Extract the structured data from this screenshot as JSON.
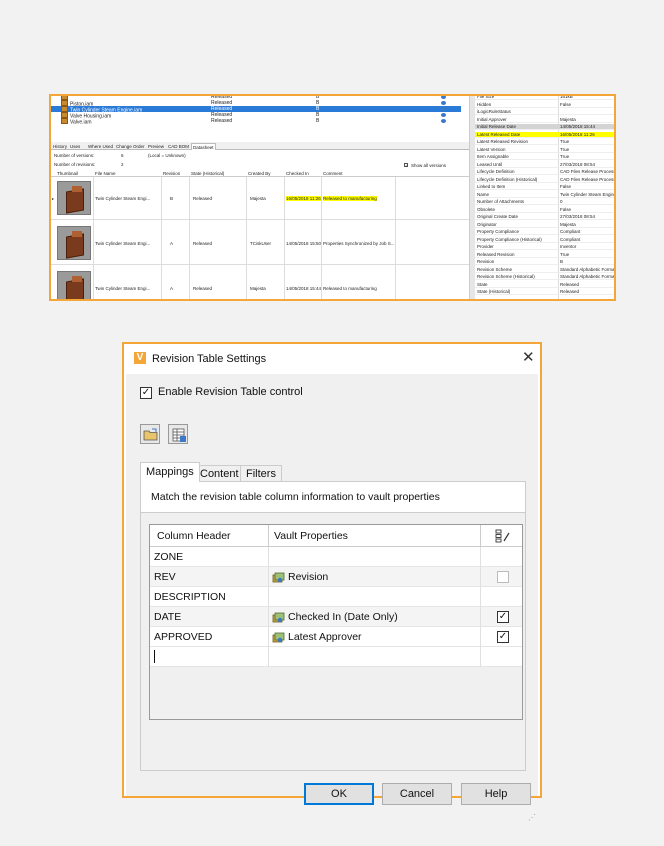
{
  "vault": {
    "files": [
      {
        "name": "",
        "state": "Released",
        "rev": "B",
        "selected": false
      },
      {
        "name": "Piston.iam",
        "state": "Released",
        "rev": "B",
        "selected": false
      },
      {
        "name": "Twin Cylinder Steam Engine.iam",
        "state": "Released",
        "rev": "B",
        "selected": true
      },
      {
        "name": "Valve Housing.iam",
        "state": "Released",
        "rev": "B",
        "selected": false
      },
      {
        "name": "Valve.iam",
        "state": "Released",
        "rev": "B",
        "selected": false
      }
    ],
    "tabs": [
      "History",
      "Uses",
      "Where Used",
      "Change Order",
      "Preview",
      "CAD BOM",
      "Datasheet"
    ],
    "versions_label": "Number of versions:",
    "versions_value": "6",
    "local_note": "(Local = Unknown)",
    "revisions_label": "Number of revisions:",
    "revisions_value": "2",
    "show_all": "Show all versions",
    "history_headers": [
      "Thumbnail",
      "File Name",
      "Revision",
      "State (Historical)",
      "Created By",
      "Checked In",
      "Comment"
    ],
    "history_rows": [
      {
        "file": "Twin Cylinder Steam Engi...",
        "rev": "B",
        "state": "Released",
        "by": "Majesta",
        "checked": "16/05/2018 11:26",
        "comment": "Released to manufacturing",
        "highlight": true
      },
      {
        "file": "Twin Cylinder Steam Engi...",
        "rev": "A",
        "state": "Released",
        "by": "TCiskUser",
        "checked": "14/05/2018 15:50",
        "comment": "Properties Synchronized by Job S...",
        "highlight": false
      },
      {
        "file": "Twin Cylinder Steam Engi...",
        "rev": "A",
        "state": "Released",
        "by": "Majesta",
        "checked": "14/05/2018 15:44",
        "comment": "Released to manufacturing",
        "highlight": false
      }
    ],
    "properties": [
      {
        "name": "File Size",
        "value": "161kB",
        "style": ""
      },
      {
        "name": "Hidden",
        "value": "False",
        "style": ""
      },
      {
        "name": "iLogicRuleStatus",
        "value": "",
        "style": ""
      },
      {
        "name": "Initial Approver",
        "value": "Majesta",
        "style": ""
      },
      {
        "name": "Initial Release Date",
        "value": "14/05/2018 15:44",
        "style": "gray"
      },
      {
        "name": "Latest Released Date",
        "value": "16/05/2018 11:26",
        "style": "yellow"
      },
      {
        "name": "Latest Released Revision",
        "value": "True",
        "style": ""
      },
      {
        "name": "Latest Version",
        "value": "True",
        "style": ""
      },
      {
        "name": "Item Assignable",
        "value": "True",
        "style": ""
      },
      {
        "name": "Leased Until",
        "value": "27/03/2018 08:54",
        "style": ""
      },
      {
        "name": "Lifecycle Definition",
        "value": "CAD Files Release Process",
        "style": ""
      },
      {
        "name": "Lifecycle Definition (Historical)",
        "value": "CAD Files Release Process",
        "style": ""
      },
      {
        "name": "Linked to Item",
        "value": "False",
        "style": ""
      },
      {
        "name": "Name",
        "value": "Twin Cylinder Steam Engine",
        "style": ""
      },
      {
        "name": "Number of Attachments",
        "value": "0",
        "style": ""
      },
      {
        "name": "Obsolete",
        "value": "False",
        "style": ""
      },
      {
        "name": "Original Create Date",
        "value": "27/03/2018 08:54",
        "style": ""
      },
      {
        "name": "Originator",
        "value": "Majesta",
        "style": ""
      },
      {
        "name": "Property Compliance",
        "value": "Compliant",
        "style": ""
      },
      {
        "name": "Property Compliance (Historical)",
        "value": "Compliant",
        "style": ""
      },
      {
        "name": "Provider",
        "value": "Inventor",
        "style": ""
      },
      {
        "name": "Released Revision",
        "value": "True",
        "style": ""
      },
      {
        "name": "Revision",
        "value": "B",
        "style": ""
      },
      {
        "name": "Revision Scheme",
        "value": "Standard Alphabetic Format",
        "style": ""
      },
      {
        "name": "Revision Scheme (Historical)",
        "value": "Standard Alphabetic Format",
        "style": ""
      },
      {
        "name": "State",
        "value": "Released",
        "style": ""
      },
      {
        "name": "State (Historical)",
        "value": "Released",
        "style": ""
      }
    ]
  },
  "dialog": {
    "app_icon": "V",
    "title": "Revision Table Settings",
    "close_glyph": "✕",
    "enable_label": "Enable Revision Table control",
    "enable_checked": true,
    "toolbar_icons": [
      "open-folder-icon",
      "import-table-icon"
    ],
    "tabs": [
      "Mappings",
      "Content",
      "Filters"
    ],
    "active_tab": "Mappings",
    "description": "Match the revision table column information to vault properties",
    "grid_headers": [
      "Column Header",
      "Vault Properties"
    ],
    "grid_header_icon": "edit-mapping-icon",
    "rows": [
      {
        "header": "ZONE",
        "property": "",
        "has_icon": false,
        "checkbox": "none"
      },
      {
        "header": "REV",
        "property": "Revision",
        "has_icon": true,
        "checkbox": "disabled"
      },
      {
        "header": "DESCRIPTION",
        "property": "",
        "has_icon": false,
        "checkbox": "none"
      },
      {
        "header": "DATE",
        "property": "Checked In (Date Only)",
        "has_icon": true,
        "checkbox": "checked"
      },
      {
        "header": "APPROVED",
        "property": "Latest Approver",
        "has_icon": true,
        "checkbox": "checked"
      }
    ],
    "check_glyph": "✓",
    "buttons": {
      "ok": "OK",
      "cancel": "Cancel",
      "help": "Help"
    },
    "grip_glyph": "⋰"
  },
  "colors": {
    "accent_border": "#f4a638",
    "selection": "#2a7bd8",
    "highlight": "#ffff00",
    "default_button": "#0078d7"
  }
}
